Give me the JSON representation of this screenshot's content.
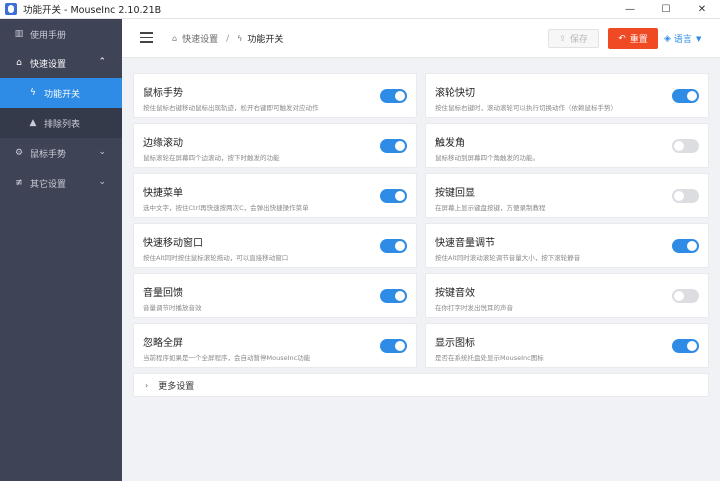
{
  "window": {
    "title": "功能开关 - MouseInc 2.10.21B",
    "minimize_glyph": "—",
    "maximize_glyph": "☐",
    "close_glyph": "✕"
  },
  "sidebar": {
    "items": [
      {
        "label": "使用手册",
        "icon": "book-icon",
        "glyph": "▥"
      },
      {
        "label": "快速设置",
        "icon": "home-icon",
        "glyph": "⌂",
        "chevron": "⌃"
      },
      {
        "label": "功能开关",
        "icon": "bolt-icon",
        "glyph": "ϟ"
      },
      {
        "label": "排除列表",
        "icon": "warning-icon",
        "glyph": "▲"
      },
      {
        "label": "鼠标手势",
        "icon": "gear-icon",
        "glyph": "⚙",
        "chevron": "⌄"
      },
      {
        "label": "其它设置",
        "icon": "sliders-icon",
        "glyph": "≢",
        "chevron": "⌄"
      }
    ]
  },
  "header": {
    "breadcrumb": {
      "parent": "快速设置",
      "separator": "/",
      "current": "功能开关"
    },
    "save_label": "保存",
    "reset_label": "重置",
    "language_label": "语言"
  },
  "features": [
    {
      "title": "鼠标手势",
      "desc": "按住鼠标右键移动鼠标出现轨迹，松开右键即可触发对应动作",
      "enabled": true
    },
    {
      "title": "滚轮快切",
      "desc": "按住鼠标右键时，滚动滚轮可以执行切换动作（依赖鼠标手势）",
      "enabled": true
    },
    {
      "title": "边缘滚动",
      "desc": "鼠标滚轮在屏幕四个边滚动，按下时触发的功能",
      "enabled": true
    },
    {
      "title": "触发角",
      "desc": "鼠标移动到屏幕四个角触发的功能。",
      "enabled": false
    },
    {
      "title": "快捷菜单",
      "desc": "选中文字，按住Ctrl再快速按两次C，会弹出快捷操作菜单",
      "enabled": true
    },
    {
      "title": "按键回显",
      "desc": "在屏幕上显示键盘按键，方便录制教程",
      "enabled": false
    },
    {
      "title": "快速移动窗口",
      "desc": "按住Alt同时按住鼠标滚轮拖动，可以直接移动窗口",
      "enabled": true
    },
    {
      "title": "快速音量调节",
      "desc": "按住Alt同时滚动滚轮调节音量大小，按下滚轮静音",
      "enabled": true
    },
    {
      "title": "音量回馈",
      "desc": "音量调节时播放音效",
      "enabled": true
    },
    {
      "title": "按键音效",
      "desc": "在你打字时发出悦耳的声音",
      "enabled": false
    },
    {
      "title": "忽略全屏",
      "desc": "当前程序如果是一个全屏程序，会自动暂停MouseInc功能",
      "enabled": true
    },
    {
      "title": "显示图标",
      "desc": "是否在系统托盘处显示MouseInc图标",
      "enabled": true
    }
  ],
  "more_settings": {
    "label": "更多设置",
    "chevron": "›"
  },
  "colors": {
    "accent": "#2f8ce6",
    "danger": "#ef4a23",
    "sidebar": "#3e4356",
    "toggle_off": "#dcdde0"
  }
}
